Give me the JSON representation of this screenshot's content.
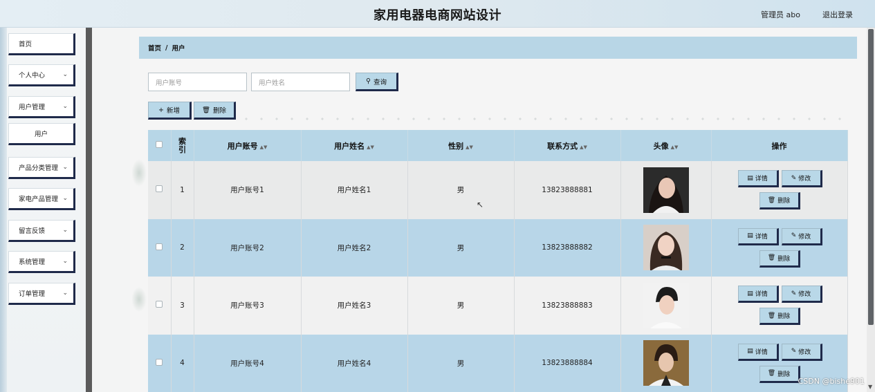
{
  "header": {
    "title": "家用电器电商网站设计",
    "user": "管理员 abo",
    "logout": "退出登录"
  },
  "sidebar": {
    "items": [
      {
        "label": "首页",
        "has_chevron": false
      },
      {
        "label": "个人中心",
        "has_chevron": true
      },
      {
        "label": "用户管理",
        "has_chevron": true
      },
      {
        "label": "用户",
        "has_chevron": false
      },
      {
        "label": "产品分类管理",
        "has_chevron": true
      },
      {
        "label": "家电产品管理",
        "has_chevron": true
      },
      {
        "label": "留言反馈",
        "has_chevron": true
      },
      {
        "label": "系统管理",
        "has_chevron": true
      },
      {
        "label": "订单管理",
        "has_chevron": true
      }
    ]
  },
  "breadcrumb": {
    "home": "首页",
    "separator": "/",
    "current": "用户"
  },
  "search": {
    "account_placeholder": "用户账号",
    "name_placeholder": "用户姓名",
    "query_label": "查询"
  },
  "toolbar": {
    "add_label": "新增",
    "delete_label": "删除"
  },
  "table": {
    "headers": {
      "index": "索引",
      "account": "用户账号",
      "name": "用户姓名",
      "gender": "性别",
      "phone": "联系方式",
      "avatar": "头像",
      "ops": "操作"
    },
    "rows": [
      {
        "index": "1",
        "account": "用户账号1",
        "name": "用户姓名1",
        "gender": "男",
        "phone": "13823888881"
      },
      {
        "index": "2",
        "account": "用户账号2",
        "name": "用户姓名2",
        "gender": "男",
        "phone": "13823888882"
      },
      {
        "index": "3",
        "account": "用户账号3",
        "name": "用户姓名3",
        "gender": "男",
        "phone": "13823888883"
      },
      {
        "index": "4",
        "account": "用户账号4",
        "name": "用户姓名4",
        "gender": "男",
        "phone": "13823888884"
      }
    ],
    "row_actions": {
      "detail": "详情",
      "edit": "修改",
      "delete": "删除"
    }
  },
  "watermark": "CSDN @bishe901",
  "colors": {
    "accent": "#b8d6e8",
    "button_shadow": "#1f2a4a",
    "divider": "#5b5b5b"
  }
}
